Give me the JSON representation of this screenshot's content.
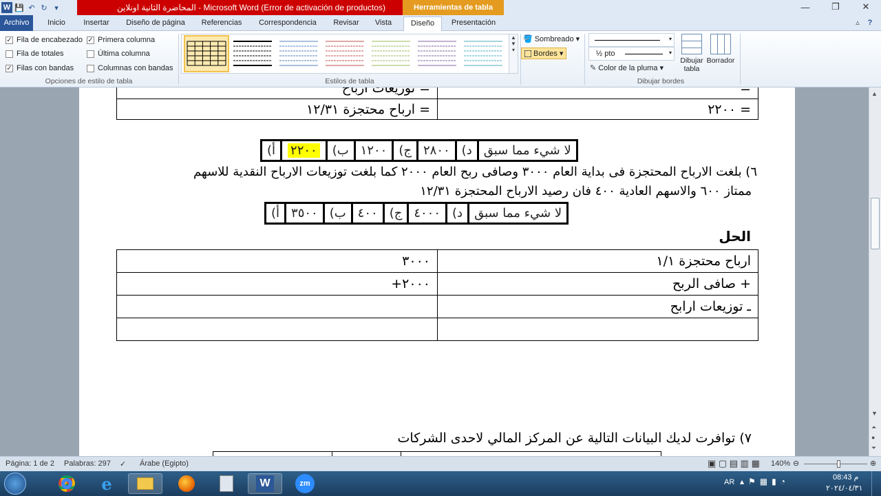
{
  "window": {
    "title": "المحاضرة الثانية اونلاين - Microsoft Word (Error de activación de productos)",
    "context_tab": "Herramientas de tabla"
  },
  "tabs": [
    "Archivo",
    "Inicio",
    "Insertar",
    "Diseño de página",
    "Referencias",
    "Correspondencia",
    "Revisar",
    "Vista",
    "Diseño",
    "Presentación"
  ],
  "ribbon": {
    "table_style_options": {
      "items": [
        {
          "label": "Fila de encabezado",
          "checked": true
        },
        {
          "label": "Fila de totales",
          "checked": false
        },
        {
          "label": "Filas con bandas",
          "checked": true
        },
        {
          "label": "Primera columna",
          "checked": true
        },
        {
          "label": "Última columna",
          "checked": false
        },
        {
          "label": "Columnas con bandas",
          "checked": false
        }
      ],
      "group_label": "Opciones de estilo de tabla"
    },
    "table_styles": {
      "group_label": "Estilos de tabla",
      "colors": [
        "#000000",
        "#000000",
        "#4f81bd",
        "#c0504d",
        "#9bbb59",
        "#8064a2",
        "#4bacc6"
      ]
    },
    "sombreado": "Sombreado",
    "bordes": "Bordes",
    "pen_weight": "½ pto",
    "pen_color": "Color de la pluma",
    "draw_table": "Dibujar tabla",
    "eraser": "Borrador",
    "draw_borders_label": "Dibujar bordes"
  },
  "doc": {
    "top_table": {
      "row1": [
        "= توزيعات ارباح",
        "="
      ],
      "row2": [
        "= ارباح محتجزة ١٢/٣١",
        "= ٢٢٠٠"
      ]
    },
    "q5_options": [
      {
        "letter": "أ)",
        "value": "٢٢٠٠",
        "highlight": true
      },
      {
        "letter": "ب)",
        "value": "١٢٠٠"
      },
      {
        "letter": "ج)",
        "value": "٢٨٠٠"
      },
      {
        "letter": "د)",
        "value": "لا شيء مما سبق"
      }
    ],
    "q6_line1": "٦) بلغت الارباح المحتجزة فى بداية العام ٣٠٠٠ وصافى ربح العام ٢٠٠٠ كما بلغت توزيعات الارباح النقدية للاسهم",
    "q6_line2": "ممتاز ٦٠٠ والاسهم العادية ٤٠٠ فان رصيد الارباح المحتجزة ١٢/٣١",
    "q6_options": [
      {
        "letter": "أ)",
        "value": "٣٥٠٠"
      },
      {
        "letter": "ب)",
        "value": "٤٠٠"
      },
      {
        "letter": "ج)",
        "value": "٤٠٠٠"
      },
      {
        "letter": "د)",
        "value": "لا شيء مما سبق"
      }
    ],
    "solution_heading": "الحل",
    "solution_table": [
      [
        "ارباح محتجزة ١/١",
        "٣٠٠٠"
      ],
      [
        "+ صافى الربح",
        "٢٠٠٠+"
      ],
      [
        "ـ توزيعات ارابح",
        ""
      ],
      [
        "",
        ""
      ]
    ],
    "q7": "٧) توافرت لديك البيانات  التالية عن المركز المالي لاحدى الشركات"
  },
  "status": {
    "page": "Página: 1 de 2",
    "words": "Palabras: 297",
    "lang": "Árabe (Egipto)",
    "zoom": "140%"
  },
  "taskbar": {
    "lang": "AR",
    "time": "08:43 م",
    "date": "٢٠٢٤/٠٤/٣١",
    "apps": [
      "chrome-icon",
      "ie-icon",
      "explorer-icon",
      "firefox-icon",
      "calculator-icon",
      "word-icon",
      "zoom-icon"
    ]
  }
}
